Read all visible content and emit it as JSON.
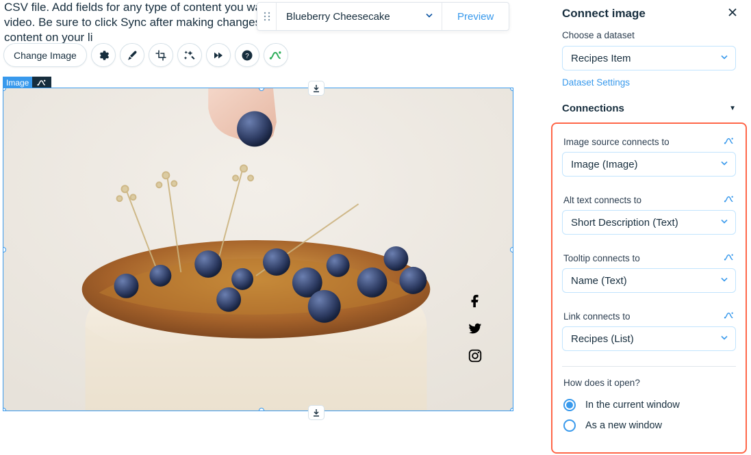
{
  "editor": {
    "bg_text": "CSV file. Add fields for any type of content you want to display, such as rich text, images, and video. Be sure to click Sync after making changes in a collection, so visitors can see your newest content on your li",
    "item_bar": {
      "selected": "Blueberry Cheesecake",
      "preview": "Preview"
    },
    "toolbar": {
      "change_image": "Change Image"
    },
    "selection_label": "Image"
  },
  "panel": {
    "title": "Connect image",
    "choose_dataset_label": "Choose a dataset",
    "dataset_value": "Recipes Item",
    "dataset_settings": "Dataset Settings",
    "connections_label": "Connections",
    "fields": {
      "image_src": {
        "label": "Image source connects to",
        "value": "Image (Image)"
      },
      "alt": {
        "label": "Alt text connects to",
        "value": "Short Description (Text)"
      },
      "tooltip": {
        "label": "Tooltip connects to",
        "value": "Name (Text)"
      },
      "link": {
        "label": "Link connects to",
        "value": "Recipes (List)"
      }
    },
    "open_q": "How does it open?",
    "open_opts": {
      "current": "In the current window",
      "new": "As a new window"
    }
  }
}
